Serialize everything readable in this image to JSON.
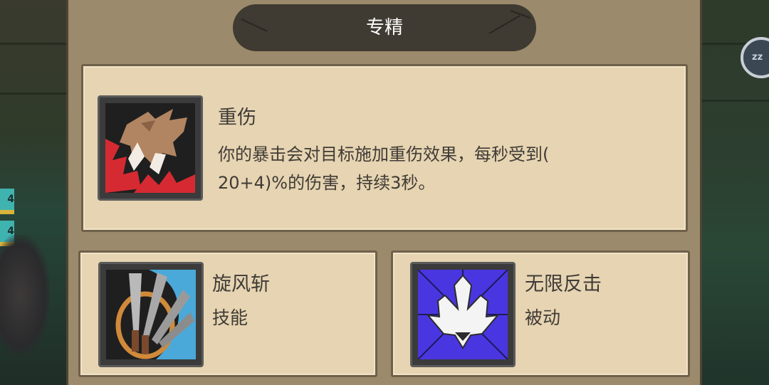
{
  "panel_title": "专精",
  "main_skill": {
    "name": "重伤",
    "description_line1": "你的暴击会对目标施加重伤效果，每秒受到(",
    "description_line2": "20+4)%的伤害，持续3秒。",
    "icon": "wolf-claw-bleed-icon"
  },
  "skills": [
    {
      "name": "旋风斩",
      "type": "技能",
      "icon": "whirlwind-blades-icon"
    },
    {
      "name": "无限反击",
      "type": "被动",
      "icon": "counter-crown-icon"
    }
  ],
  "hud": {
    "strip_1": "4",
    "strip_2": "4",
    "sleep_button": "zz"
  },
  "colors": {
    "panel_bg": "#9b8a6b",
    "card_bg": "#e6d4b2",
    "title_bar": "#3f3a32",
    "text": "#403b36"
  }
}
